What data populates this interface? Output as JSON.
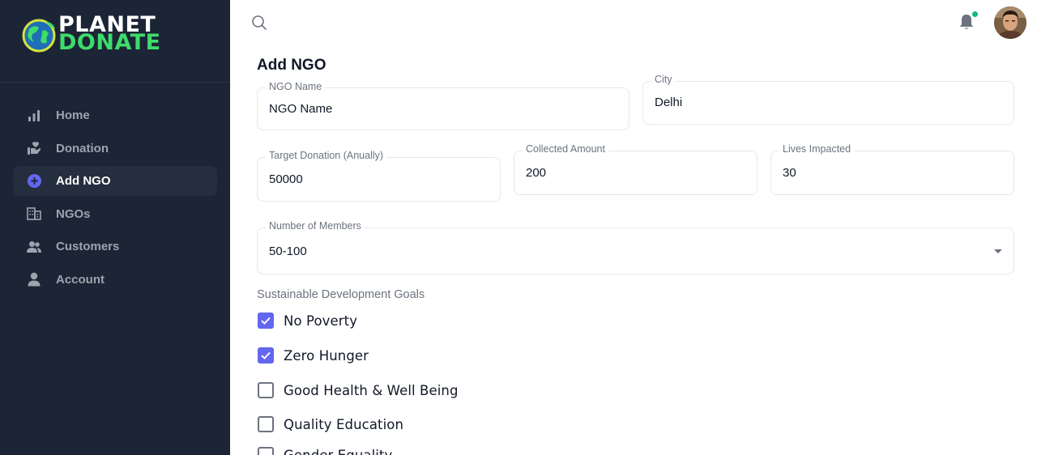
{
  "brand": {
    "line1": "PLANET",
    "line2": "DONATE",
    "accent_color": "#3ddc6b"
  },
  "sidebar": {
    "background": "#1c2536",
    "active_item": "Add NGO",
    "items": [
      {
        "label": "Home",
        "icon": "bar-chart-icon"
      },
      {
        "label": "Donation",
        "icon": "hand-heart-icon"
      },
      {
        "label": "Add NGO",
        "icon": "plus-circle-icon"
      },
      {
        "label": "NGOs",
        "icon": "building-icon"
      },
      {
        "label": "Customers",
        "icon": "users-icon"
      },
      {
        "label": "Account",
        "icon": "user-icon"
      }
    ]
  },
  "header": {
    "search_icon": "search-icon",
    "notification_icon": "bell-icon",
    "has_notification": true
  },
  "form": {
    "title": "Add NGO",
    "ngo_name": {
      "label": "NGO Name",
      "value": "NGO Name"
    },
    "city": {
      "label": "City",
      "value": "Delhi"
    },
    "target_donation": {
      "label": "Target Donation (Anually)",
      "value": "50000"
    },
    "collected_amount": {
      "label": "Collected Amount",
      "value": "200"
    },
    "lives_impacted": {
      "label": "Lives Impacted",
      "value": "30"
    },
    "members": {
      "label": "Number of Members",
      "value": "50-100"
    },
    "sdg": {
      "title": "Sustainable Development Goals",
      "goals": [
        {
          "label": "No Poverty",
          "checked": true
        },
        {
          "label": "Zero Hunger",
          "checked": true
        },
        {
          "label": "Good Health & Well Being",
          "checked": false
        },
        {
          "label": "Quality Education",
          "checked": false
        },
        {
          "label": "Gender Equality",
          "checked": false
        }
      ]
    },
    "accent_color": "#6366f1"
  }
}
